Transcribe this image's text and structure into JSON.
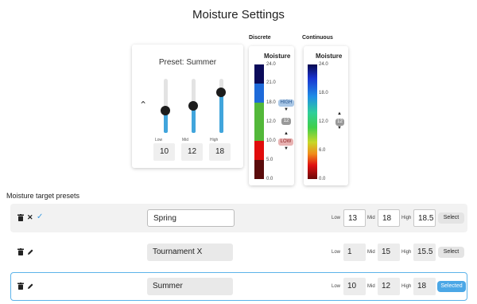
{
  "title": "Moisture Settings",
  "preset_panel": {
    "title": "Preset: Summer",
    "sliders": [
      {
        "label": "Low",
        "value": "10",
        "level": 0.4167
      },
      {
        "label": "Mid",
        "value": "12",
        "level": 0.5
      },
      {
        "label": "High",
        "value": "18",
        "level": 0.75
      }
    ]
  },
  "discrete": {
    "heading": "Discrete",
    "title": "Moisture",
    "ticks": [
      "24.0",
      "21.0",
      "18.0",
      "12.0",
      "10.0",
      "5.0",
      "0.0"
    ],
    "high_tag": "HIGH",
    "mid_tag": "12",
    "low_tag": "LOW"
  },
  "continuous": {
    "heading": "Continuous",
    "title": "Moisture",
    "ticks": [
      "24.0",
      "18.0",
      "12.0",
      "6.0",
      "0.0"
    ],
    "mid_tag": "12"
  },
  "presets_section": {
    "label": "Moisture target presets",
    "low_label": "Low",
    "mid_label": "Mid",
    "high_label": "High",
    "rows": [
      {
        "name": "Spring",
        "low": "13",
        "mid": "18",
        "high": "18.5",
        "button": "Select"
      },
      {
        "name": "Tournament X",
        "low": "1",
        "mid": "15",
        "high": "15.5",
        "button": "Select"
      },
      {
        "name": "Summer",
        "low": "10",
        "mid": "12",
        "high": "18",
        "button": "Selected"
      }
    ]
  },
  "colors": {
    "accent": "#41a5dc",
    "selected_border": "#5cb3ea",
    "discrete_bands": [
      "#0b0b5a",
      "#1e6ad9",
      "#53b83a",
      "#e00c0c",
      "#5a0b0b"
    ]
  },
  "icons": {
    "trash": "trash-icon",
    "close": "close-icon",
    "check": "check-icon",
    "pencil": "pencil-icon",
    "collapse": "chevron-up-icon"
  }
}
